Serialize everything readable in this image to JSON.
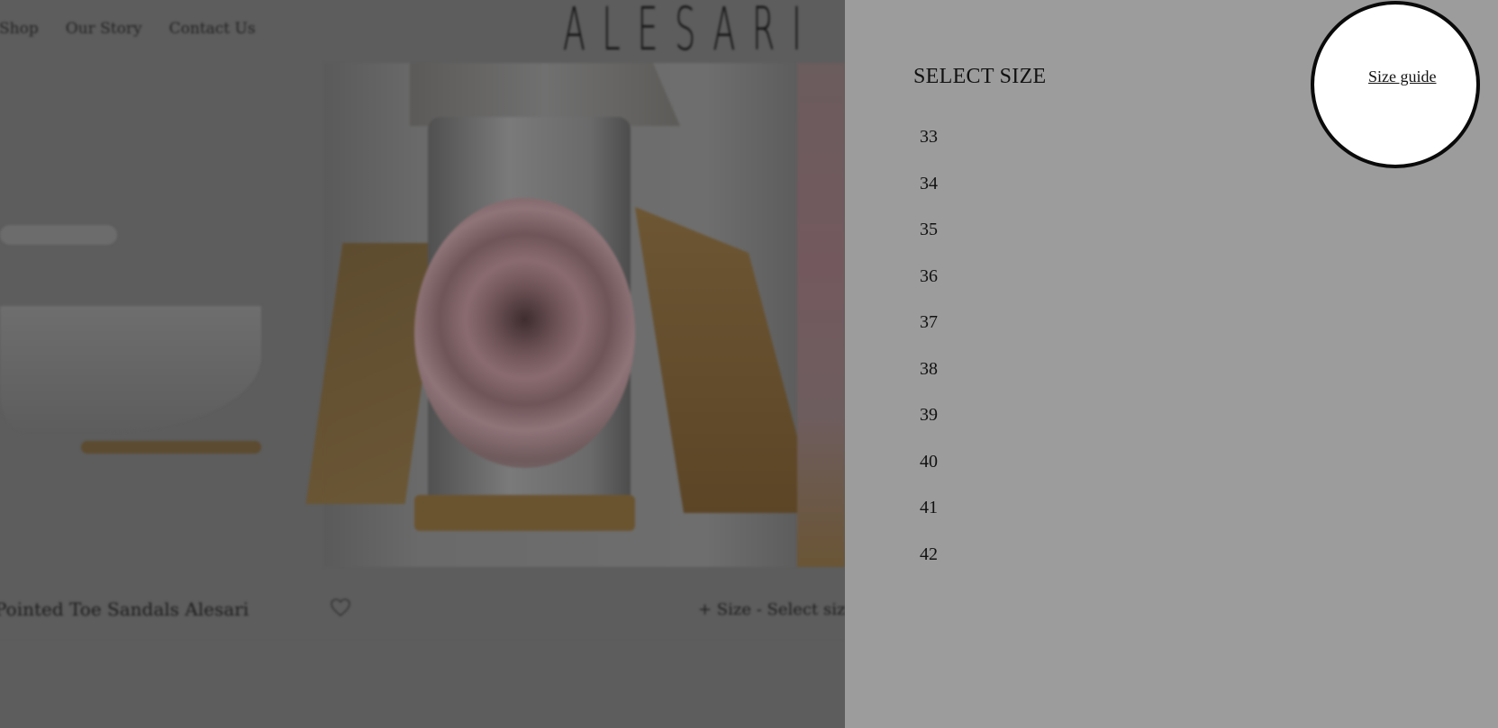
{
  "nav": {
    "items": [
      "Shop",
      "Our Story",
      "Contact Us"
    ]
  },
  "brand": {
    "logo_text": "ALESARI"
  },
  "product": {
    "title": "Pointed Toe Sandals Alesari",
    "size_select_label": "+ Size - Select size"
  },
  "size_drawer": {
    "title": "SELECT SIZE",
    "guide_label": "Size guide",
    "sizes": [
      "33",
      "34",
      "35",
      "36",
      "37",
      "38",
      "39",
      "40",
      "41",
      "42"
    ]
  },
  "colors": {
    "overlay": "#5d5d5d",
    "drawer_bg": "#9c9c9c",
    "highlight_circle": "#ffffff"
  }
}
